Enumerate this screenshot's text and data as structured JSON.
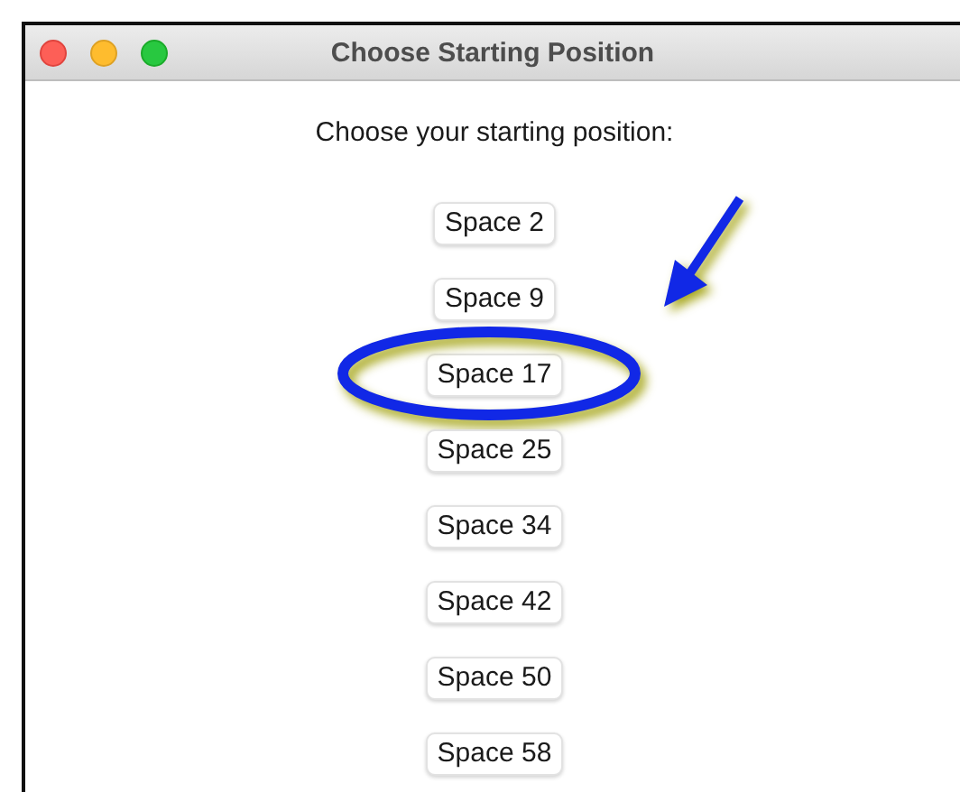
{
  "window": {
    "title": "Choose Starting Position"
  },
  "prompt": "Choose your starting position:",
  "buttons": [
    {
      "label": "Space 2",
      "highlighted": false
    },
    {
      "label": "Space 9",
      "highlighted": false
    },
    {
      "label": "Space 17",
      "highlighted": true
    },
    {
      "label": "Space 25",
      "highlighted": false
    },
    {
      "label": "Space 34",
      "highlighted": false
    },
    {
      "label": "Space 42",
      "highlighted": false
    },
    {
      "label": "Space 50",
      "highlighted": false
    },
    {
      "label": "Space 58",
      "highlighted": false
    }
  ]
}
